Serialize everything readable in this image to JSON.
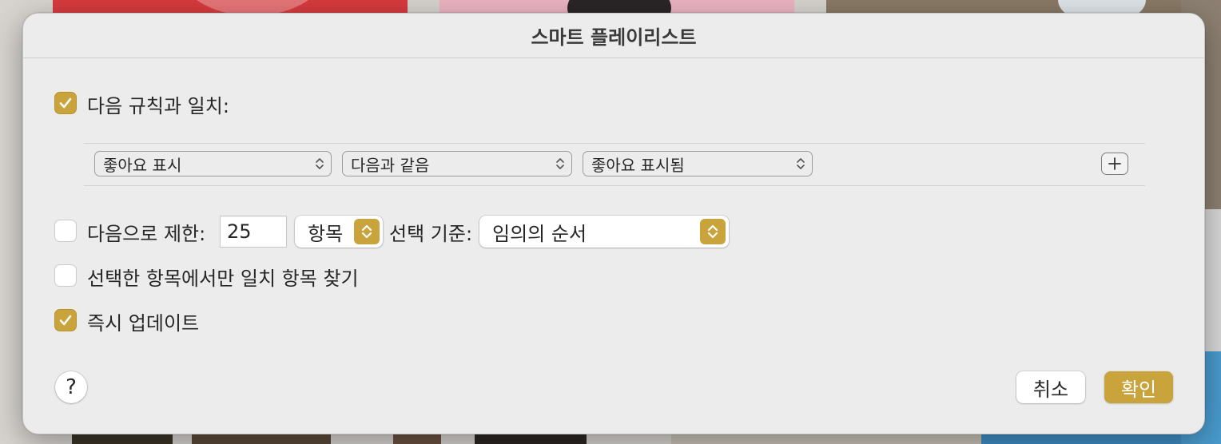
{
  "dialog": {
    "title": "스마트 플레이리스트",
    "match_rules": {
      "label": "다음 규칙과 일치:",
      "checked": true
    },
    "rule": {
      "field": "좋아요 표시",
      "operator": "다음과 같음",
      "value": "좋아요 표시됨",
      "add_icon": "plus-icon"
    },
    "limit": {
      "label": "다음으로 제한:",
      "checked": false,
      "count": "25",
      "unit": "항목",
      "selected_by_label": "선택 기준:",
      "selected_by": "임의의 순서"
    },
    "match_checked_only": {
      "label": "선택한 항목에서만 일치 항목 찾기",
      "checked": false
    },
    "live_updating": {
      "label": "즉시 업데이트",
      "checked": true
    },
    "help_label": "?",
    "cancel_label": "취소",
    "ok_label": "확인"
  },
  "colors": {
    "accent": "#c9a43c",
    "dialog_bg": "#ececec"
  }
}
